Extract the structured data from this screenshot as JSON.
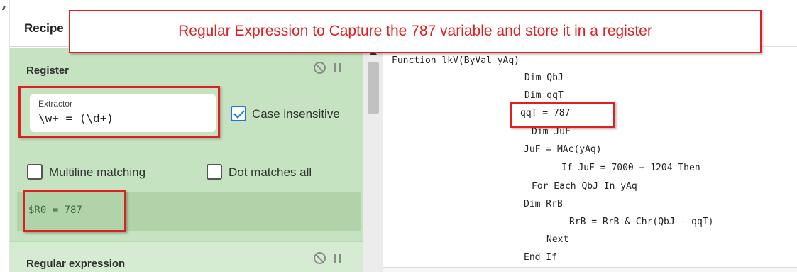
{
  "recipe": {
    "title": "Recipe"
  },
  "register_op": {
    "title": "Register",
    "extractor_label": "Extractor",
    "extractor_value": "\\w+ = (\\d+)",
    "case_insensitive_label": "Case insensitive",
    "case_insensitive_checked": true,
    "multiline_label": "Multiline matching",
    "multiline_checked": false,
    "dotall_label": "Dot matches all",
    "dotall_checked": false,
    "output": "$R0 = 787"
  },
  "regex_op": {
    "title": "Regular expression"
  },
  "icons": {
    "disable": "disable-icon",
    "pause": "pause-icon",
    "scroll_up": "chevron-up-icon"
  },
  "annotation": {
    "banner_text": "Regular Expression to Capture the 787 variable and store it in a register",
    "highlight_color": "#e02020"
  },
  "code": {
    "lines": [
      "Function lkV(ByVal yAq)",
      "Dim QbJ",
      "Dim qqT",
      "qqT = 787",
      "Dim JuF",
      "JuF = MAc(yAq)",
      "If JuF = 7000 + 1204 Then",
      "For Each QbJ In yAq",
      "Dim RrB",
      "RrB = RrB & Chr(QbJ - qqT)",
      "Next",
      "End If"
    ]
  },
  "colors": {
    "op_background": "#c5e3c0",
    "output_background": "#b0d3aa",
    "checkbox_accent": "#1a73e8"
  }
}
